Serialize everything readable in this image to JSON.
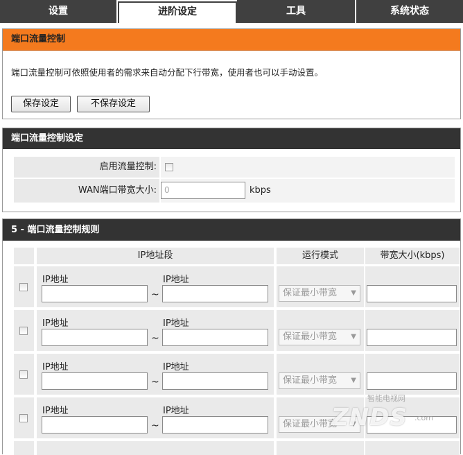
{
  "tabs": [
    {
      "label": "设置"
    },
    {
      "label": "进阶设定"
    },
    {
      "label": "工具"
    },
    {
      "label": "系统状态"
    }
  ],
  "section1": {
    "title": "端口流量控制",
    "description": "端口流量控制可依照使用者的需求来自动分配下行带宽，使用者也可以手动设置。",
    "save_label": "保存设定",
    "nosave_label": "不保存设定"
  },
  "section2": {
    "title": "端口流量控制设定",
    "enable_label": "启用流量控制:",
    "wan_label": "WAN端口带宽大小:",
    "wan_value": "0",
    "wan_unit": "kbps"
  },
  "section3": {
    "title": "5 - 端口流量控制规则",
    "col_ip": "IP地址段",
    "col_mode": "运行模式",
    "col_bw": "带宽大小(kbps)",
    "ip_label": "IP地址",
    "tilde": "~",
    "mode_value": "保证最小带宽",
    "rows": [
      {
        "start": "",
        "end": "",
        "bw": ""
      },
      {
        "start": "",
        "end": "",
        "bw": ""
      },
      {
        "start": "",
        "end": "",
        "bw": ""
      },
      {
        "start": "",
        "end": "",
        "bw": ""
      }
    ]
  },
  "watermark": {
    "brand": "ZNDS",
    "tagline": "智能电视网",
    "domain": ".com"
  }
}
